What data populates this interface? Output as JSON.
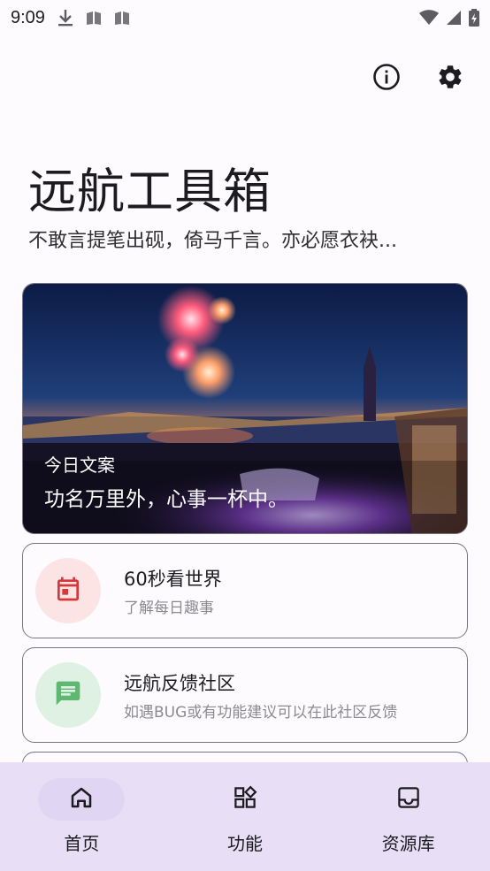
{
  "status_bar": {
    "time": "9:09",
    "icons": [
      "download-icon",
      "notification-icon",
      "notification-icon",
      "wifi-icon",
      "signal-icon",
      "battery-charging-icon"
    ]
  },
  "header": {
    "actions": [
      "info-icon",
      "settings-icon"
    ]
  },
  "app": {
    "title": "远航工具箱",
    "subtitle": "不敢言提笔出砚，倚马千言。亦必愿衣袂..."
  },
  "hero": {
    "label": "今日文案",
    "quote": "功名万里外，心事一杯中。"
  },
  "cards": [
    {
      "title": "60秒看世界",
      "desc": "了解每日趣事",
      "icon": "calendar-icon",
      "icon_color": "#d3383c",
      "icon_bg": "#fde4e4"
    },
    {
      "title": "远航反馈社区",
      "desc": "如遇BUG或有功能建议可以在此社区反馈",
      "icon": "chat-icon",
      "icon_color": "#5fb872",
      "icon_bg": "#def1e2"
    }
  ],
  "nav": {
    "items": [
      {
        "label": "首页",
        "icon": "home-icon",
        "active": true
      },
      {
        "label": "功能",
        "icon": "grid-icon",
        "active": false
      },
      {
        "label": "资源库",
        "icon": "inbox-icon",
        "active": false
      }
    ]
  },
  "colors": {
    "background": "#fefbff",
    "nav_background": "#e8dff7",
    "nav_active_pill": "#e0d6f3",
    "card_border": "#79747e"
  }
}
